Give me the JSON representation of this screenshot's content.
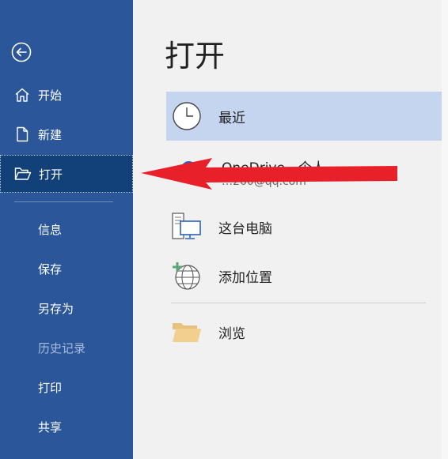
{
  "sidebar": {
    "back_icon": "back-arrow-icon",
    "items": [
      {
        "label": "开始",
        "icon": "home-icon",
        "state": "normal"
      },
      {
        "label": "新建",
        "icon": "new-document-icon",
        "state": "normal"
      },
      {
        "label": "打开",
        "icon": "open-folder-icon",
        "state": "active"
      },
      {
        "label": "信息",
        "state": "normal"
      },
      {
        "label": "保存",
        "state": "normal"
      },
      {
        "label": "另存为",
        "state": "normal"
      },
      {
        "label": "历史记录",
        "state": "disabled"
      },
      {
        "label": "打印",
        "state": "normal"
      },
      {
        "label": "共享",
        "state": "normal"
      }
    ],
    "color": "#2b579a",
    "active_color": "#124078"
  },
  "main": {
    "title": "打开",
    "locations": [
      {
        "label": "最近",
        "icon": "clock-icon",
        "selected": true
      },
      {
        "label": "OneDrive - 个人",
        "email": "…260@qq.com",
        "icon": "cloud-icon",
        "selected": false
      },
      {
        "label": "这台电脑",
        "icon": "computer-icon",
        "selected": false
      },
      {
        "label": "添加位置",
        "icon": "add-location-globe-icon",
        "selected": false
      },
      {
        "label": "浏览",
        "icon": "folder-icon",
        "selected": false
      }
    ]
  },
  "annotation": {
    "type": "red-arrow",
    "color": "#e8202a"
  }
}
